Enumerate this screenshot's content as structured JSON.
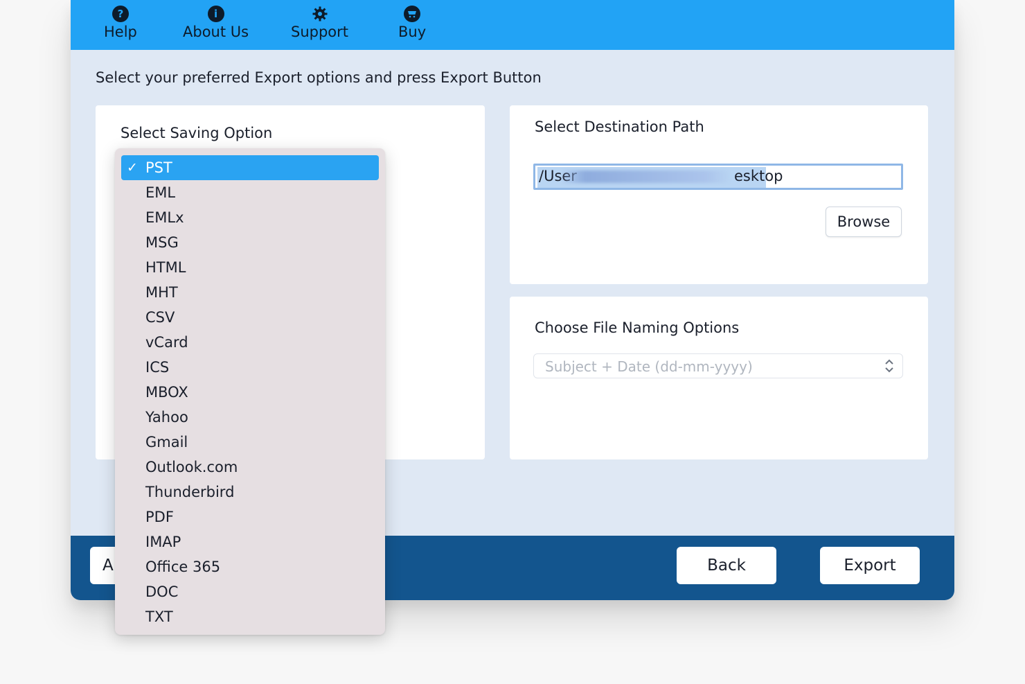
{
  "toolbar": {
    "items": [
      {
        "label": "Help",
        "icon": "question-icon"
      },
      {
        "label": "About Us",
        "icon": "info-icon"
      },
      {
        "label": "Support",
        "icon": "gear-icon"
      },
      {
        "label": "Buy",
        "icon": "cart-icon"
      }
    ]
  },
  "instruction": "Select your preferred Export options and press Export Button",
  "saving_panel": {
    "title": "Select Saving Option"
  },
  "destination_panel": {
    "title": "Select Destination Path",
    "path_prefix": "/User",
    "path_suffix": "esktop",
    "browse_label": "Browse"
  },
  "naming_panel": {
    "title": "Choose File Naming Options",
    "selected_value": "Subject + Date (dd-mm-yyyy)"
  },
  "footer": {
    "left_button_partial": "A",
    "back_label": "Back",
    "export_label": "Export"
  },
  "dropdown": {
    "checkmark": "✓",
    "selected": "PST",
    "options": [
      "PST",
      "EML",
      "EMLx",
      "MSG",
      "HTML",
      "MHT",
      "CSV",
      "vCard",
      "ICS",
      "MBOX",
      "Yahoo",
      "Gmail",
      "Outlook.com",
      "Thunderbird",
      "PDF",
      "IMAP",
      "Office 365",
      "DOC",
      "TXT"
    ]
  },
  "colors": {
    "toolbar": "#22a3f5",
    "footer": "#13558e",
    "selected_option": "#2aa3f2",
    "window_bg": "#dfe8f4"
  }
}
